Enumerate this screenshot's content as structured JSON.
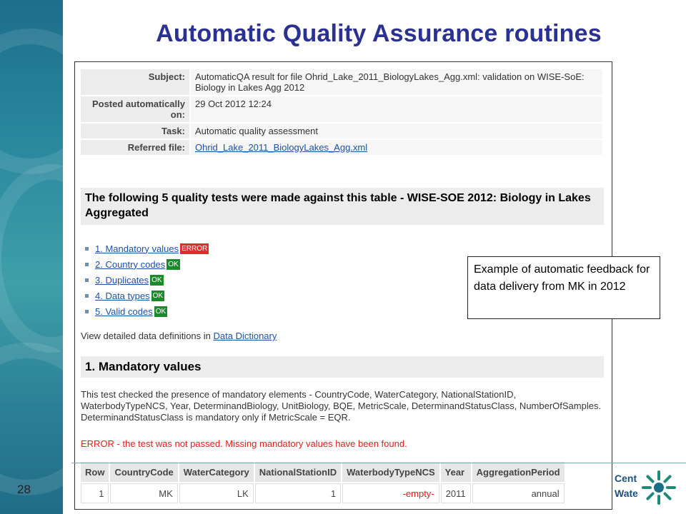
{
  "slide": {
    "title": "Automatic Quality Assurance routines",
    "number": "28",
    "logo_text": "Centre\nWaters"
  },
  "meta": [
    {
      "key": "Subject:",
      "value": "AutomaticQA result for file Ohrid_Lake_2011_BiologyLakes_Agg.xml: validation on WISE-SoE: Biology in Lakes Agg 2012"
    },
    {
      "key": "Posted automatically on:",
      "value": "29 Oct 2012 12:24"
    },
    {
      "key": "Task:",
      "value": "Automatic quality assessment"
    },
    {
      "key": "Referred file:",
      "value": "Ohrid_Lake_2011_BiologyLakes_Agg.xml"
    }
  ],
  "tests_header": "The following 5 quality tests were made against this table - WISE-SOE 2012: Biology in Lakes Aggregated",
  "tests": [
    {
      "label": "1. Mandatory values",
      "status": "ERROR"
    },
    {
      "label": "2. Country codes",
      "status": "OK"
    },
    {
      "label": "3. Duplicates",
      "status": "OK"
    },
    {
      "label": "4. Data types",
      "status": "OK"
    },
    {
      "label": "5. Valid codes",
      "status": "OK"
    }
  ],
  "dd_prefix": "View detailed data definitions in ",
  "dd_link": "Data Dictionary",
  "section_header": "1. Mandatory values",
  "description": "This test checked the presence of mandatory elements - CountryCode, WaterCategory, NationalStationID, WaterbodyTypeNCS, Year, DeterminandBiology, UnitBiology, BQE, MetricScale, DeterminandStatusClass, NumberOfSamples. DeterminandStatusClass is mandatory only if MetricScale = EQR.",
  "error_message": "ERROR - the test was not passed. Missing mandatory values have been found.",
  "table": {
    "headers": [
      "Row",
      "CountryCode",
      "WaterCategory",
      "NationalStationID",
      "WaterbodyTypeNCS",
      "Year",
      "AggregationPeriod"
    ],
    "rows": [
      [
        "1",
        "MK",
        "LK",
        "1",
        "-empty-",
        "2011",
        "annual"
      ]
    ]
  },
  "callout": "Example of automatic feedback for data delivery from MK in 2012",
  "colors": {
    "title": "#2a3192",
    "error": "#e32b2b",
    "ok": "#1a8a2a",
    "link": "#1c52a3"
  }
}
